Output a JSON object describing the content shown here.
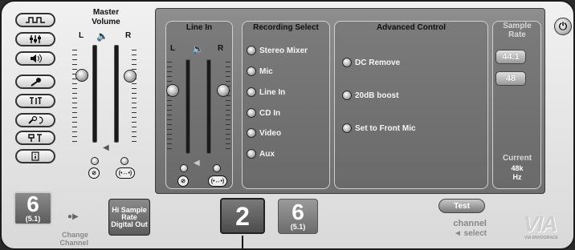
{
  "master_volume": {
    "title": "Master Volume",
    "left_label": "L",
    "right_label": "R"
  },
  "line_in": {
    "title": "Line In",
    "left_label": "L",
    "right_label": "R"
  },
  "recording_select": {
    "title": "Recording Select",
    "options": [
      "Stereo Mixer",
      "Mic",
      "Line In",
      "CD In",
      "Video",
      "Aux"
    ]
  },
  "advanced_control": {
    "title": "Advanced Control",
    "options": [
      "DC Remove",
      "20dB boost",
      "Set to Front Mic"
    ]
  },
  "sample_rate": {
    "title": "Sample Rate",
    "rates": [
      "44.1",
      "48"
    ],
    "current_label": "Current",
    "current_value": "48k",
    "current_unit": "Hz"
  },
  "bottom": {
    "channel_count": "6",
    "channel_config": "(5.1)",
    "change_channel_label": "Change Channel",
    "hi_sample_label": "Hi Sample Rate Digital Out",
    "channel_2": "2",
    "channel_6": "6",
    "channel_6_config": "(5.1)",
    "test_label": "Test",
    "channel_select_line1": "channel",
    "channel_select_line2": "◄ select",
    "logo_text": "VIA",
    "logo_sub": "VIA ENVOGRACE"
  },
  "icons": {
    "left_buttons": [
      "waveform-icon",
      "mixer-icon",
      "speaker-icon",
      "microphone-icon",
      "text-icon",
      "tools-icon",
      "equalizer-icon",
      "info-icon"
    ],
    "power": "power-icon",
    "power_glyph": "⏻"
  }
}
